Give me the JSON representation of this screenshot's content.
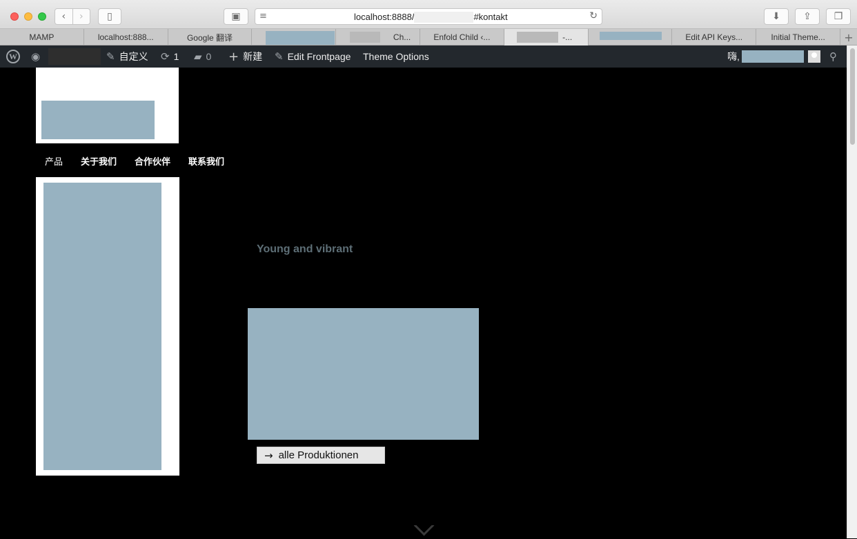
{
  "browser": {
    "url_prefix": "localhost:8888/",
    "url_suffix": "#kontakt",
    "tabs": [
      {
        "label": "MAMP"
      },
      {
        "label": "localhost:888..."
      },
      {
        "label": "Google 翻译"
      },
      {
        "label": ""
      },
      {
        "label": "Ch..."
      },
      {
        "label": "Enfold Child ‹..."
      },
      {
        "label": "-..."
      },
      {
        "label": ""
      },
      {
        "label": "Edit API Keys..."
      },
      {
        "label": "Initial Theme..."
      }
    ]
  },
  "adminbar": {
    "customize": "自定义",
    "updates_count": "1",
    "comments_count": "0",
    "new": "新建",
    "edit_frontpage": "Edit Frontpage",
    "theme_options": "Theme Options",
    "greeting": "嗨,"
  },
  "site": {
    "nav": [
      "产品",
      "关于我们",
      "合作伙伴",
      "联系我们"
    ],
    "tagline": "Young and vibrant",
    "cta_label": "alle Produktionen",
    "cta_arrow": "→"
  },
  "colors": {
    "placeholder_image": "#97b2c1",
    "admin_bar": "#23282d",
    "page_background": "#000000"
  }
}
